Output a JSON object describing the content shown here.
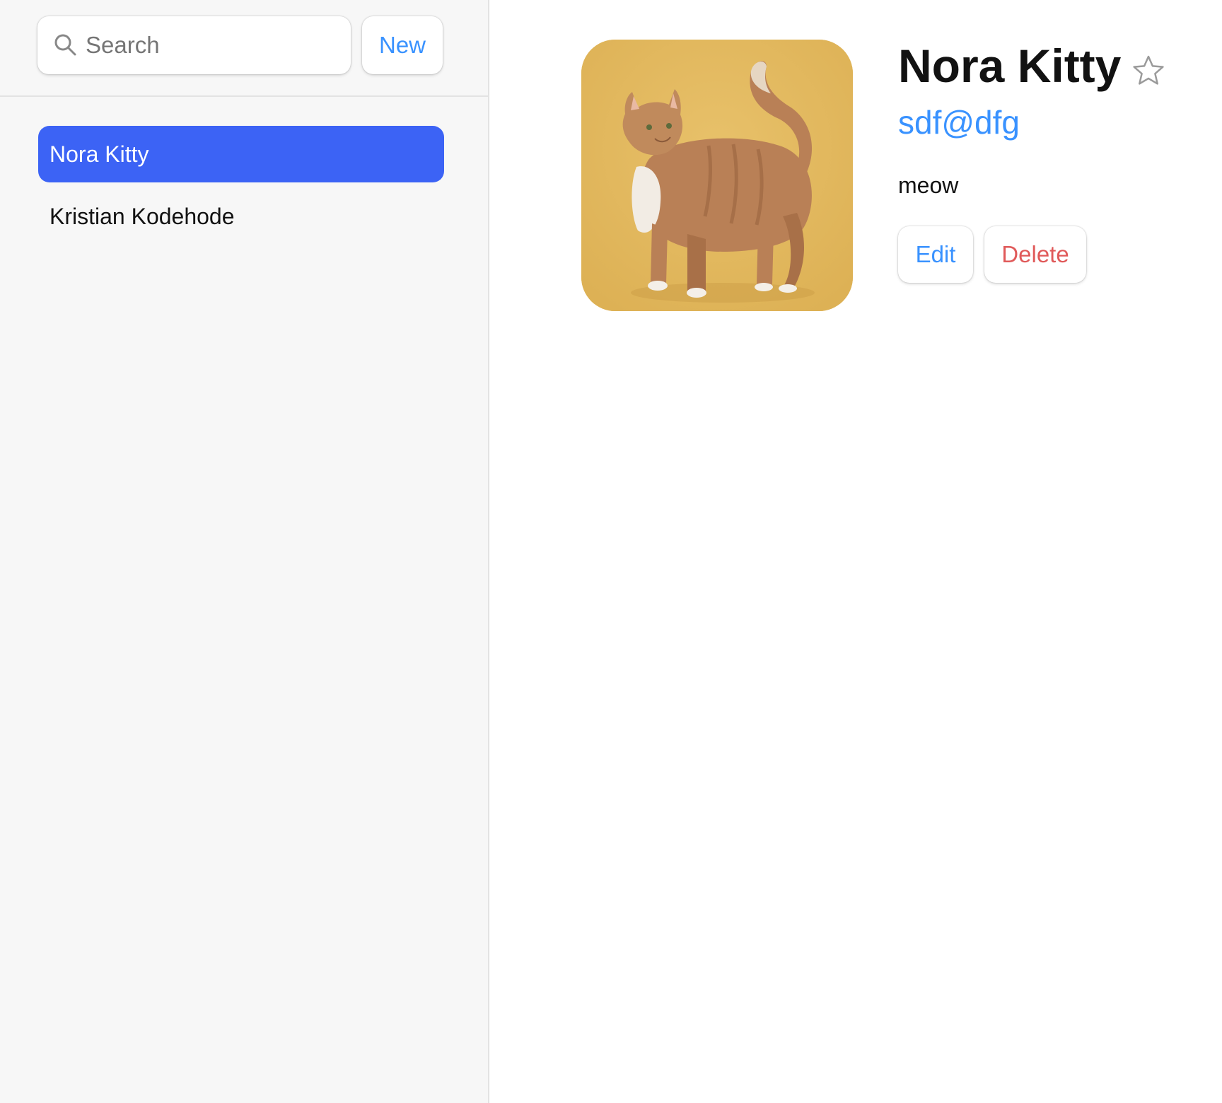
{
  "sidebar": {
    "search": {
      "placeholder": "Search",
      "value": ""
    },
    "new_button_label": "New",
    "contacts": [
      {
        "name": "Nora Kitty",
        "active": true
      },
      {
        "name": "Kristian Kodehode",
        "active": false
      }
    ]
  },
  "contact": {
    "name": "Nora Kitty",
    "twitter": "sdf@dfg",
    "notes": "meow",
    "favorite": false,
    "avatar_alt": "cat-photo",
    "edit_label": "Edit",
    "delete_label": "Delete"
  },
  "colors": {
    "accent": "#3992ff",
    "active_item": "#3c63f5",
    "danger": "#e05a5a",
    "sidebar_bg": "#f7f7f7",
    "avatar_bg": "#e4b95e"
  },
  "icons": {
    "search": "search-icon",
    "favorite": "star-outline-icon"
  }
}
